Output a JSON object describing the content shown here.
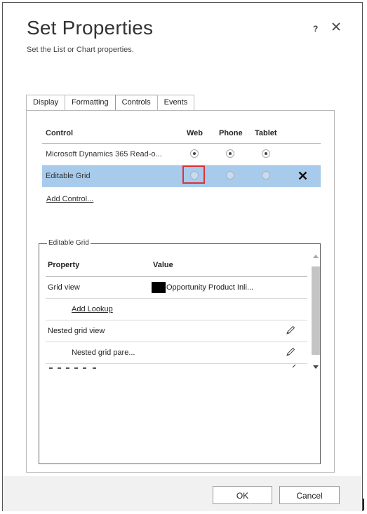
{
  "dialog": {
    "title": "Set Properties",
    "subtitle": "Set the List or Chart properties.",
    "help_label": "?",
    "close_icon": "close-icon"
  },
  "tabs": [
    {
      "label": "Display"
    },
    {
      "label": "Formatting"
    },
    {
      "label": "Controls",
      "active": true
    },
    {
      "label": "Events"
    }
  ],
  "controls": {
    "headers": {
      "control": "Control",
      "web": "Web",
      "phone": "Phone",
      "tablet": "Tablet"
    },
    "rows": [
      {
        "name": "Microsoft Dynamics 365 Read-o...",
        "web": true,
        "phone": true,
        "tablet": true,
        "selected": false
      },
      {
        "name": "Editable Grid",
        "web": false,
        "phone": false,
        "tablet": false,
        "selected": true
      }
    ],
    "add_control_label": "Add Control..."
  },
  "editable_grid": {
    "legend": "Editable Grid",
    "headers": {
      "property": "Property",
      "value": "Value"
    },
    "rows": [
      {
        "property": "Grid view",
        "value": "Opportunity Product Inli..."
      },
      {
        "property": "Add Lookup",
        "value": ""
      },
      {
        "property": "Nested grid view",
        "value": ""
      },
      {
        "property": "Nested grid pare...",
        "value": ""
      }
    ]
  },
  "footer": {
    "ok_label": "OK",
    "cancel_label": "Cancel"
  },
  "colors": {
    "selected_row": "#a8cbec",
    "focus_outline": "#d9333a",
    "footer_bg": "#f1f1f1"
  }
}
